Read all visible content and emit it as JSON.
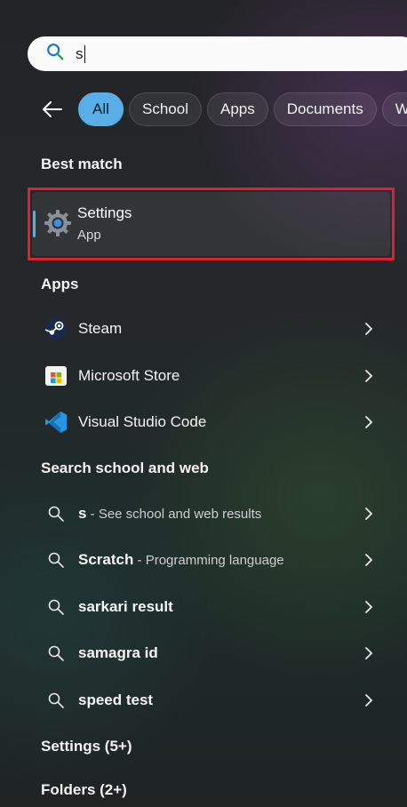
{
  "search": {
    "value": "s"
  },
  "filters": {
    "chips": [
      {
        "label": "All"
      },
      {
        "label": "School"
      },
      {
        "label": "Apps"
      },
      {
        "label": "Documents"
      },
      {
        "label": "W"
      }
    ]
  },
  "best_match": {
    "heading": "Best match",
    "title": "Settings",
    "subtitle": "App"
  },
  "apps": {
    "heading": "Apps",
    "items": [
      {
        "label": "Steam",
        "icon": "steam-icon"
      },
      {
        "label": "Microsoft Store",
        "icon": "microsoft-store-icon"
      },
      {
        "label": "Visual Studio Code",
        "icon": "vscode-icon"
      }
    ]
  },
  "web": {
    "heading": "Search school and web",
    "items": [
      {
        "bold": "s",
        "sep": " - ",
        "sub": "See school and web results"
      },
      {
        "bold": "Scratch",
        "sep": " - ",
        "sub": "Programming language"
      },
      {
        "bold": "sarkari result",
        "sep": "",
        "sub": ""
      },
      {
        "bold": "samagra id",
        "sep": "",
        "sub": ""
      },
      {
        "bold": "speed test",
        "sep": "",
        "sub": ""
      }
    ]
  },
  "more": {
    "settings": "Settings (5+)",
    "folders": "Folders (2+)"
  },
  "colors": {
    "accent": "#5aaee8",
    "highlight_border": "#e0202c"
  }
}
